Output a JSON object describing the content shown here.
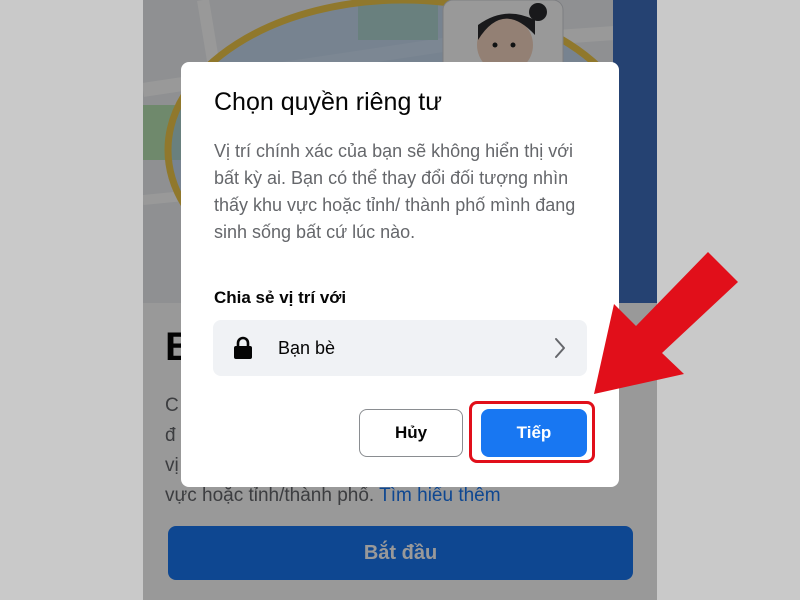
{
  "background": {
    "heading": "B",
    "description_lines": [
      "C",
      "đ",
      "vị",
      "vực hoặc tỉnh/thành phố."
    ],
    "learn_more": "Tìm hiểu thêm",
    "start_button": "Bắt đầu"
  },
  "dialog": {
    "title": "Chọn quyền riêng tư",
    "description": "Vị trí chính xác của bạn sẽ không hiển thị với bất kỳ ai. Bạn có thể thay đổi đối tượng nhìn thấy khu vực hoặc tỉnh/ thành phố mình đang sinh sống bất cứ lúc nào.",
    "share_label": "Chia sẻ vị trí với",
    "audience": {
      "label": "Bạn bè",
      "icon": "lock-icon",
      "chevron": "chevron-right-icon"
    },
    "cancel_button": "Hủy",
    "next_button": "Tiếp"
  },
  "annotation": {
    "arrow_color": "#e10f1a",
    "highlight_color": "#e10f1a"
  },
  "colors": {
    "accent": "#1877f2",
    "overlay": "rgba(0,0,0,0.40)"
  }
}
